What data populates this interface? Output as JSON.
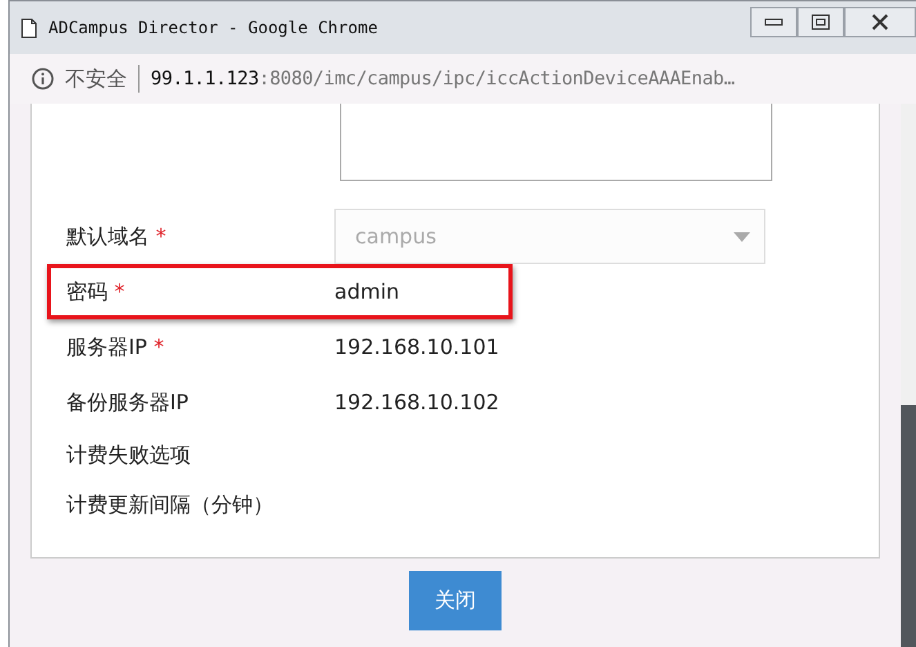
{
  "window": {
    "title": "ADCampus Director - Google Chrome"
  },
  "address_bar": {
    "security": "不安全",
    "host": "99.1.1.123",
    "path": ":8080/imc/campus/ipc/iccActionDeviceAAAEnab…"
  },
  "form": {
    "rows": [
      {
        "kind": "select",
        "label": "默认域名",
        "required_mark": "*",
        "highlighted": false,
        "value": "campus",
        "disabled": true
      },
      {
        "kind": "text",
        "label": "密码",
        "required_mark": "*",
        "highlighted": true,
        "value": "admin"
      },
      {
        "kind": "text",
        "label": "服务器IP",
        "required_mark": "*",
        "highlighted": false,
        "value": "192.168.10.101"
      },
      {
        "kind": "text",
        "label": "备份服务器IP",
        "highlighted": false,
        "value": "192.168.10.102"
      },
      {
        "kind": "label",
        "label": "计费失败选项",
        "highlighted": false
      },
      {
        "kind": "label",
        "label": "计费更新间隔（分钟）",
        "highlighted": false
      }
    ]
  },
  "buttons": [
    {
      "label": "关闭"
    }
  ]
}
